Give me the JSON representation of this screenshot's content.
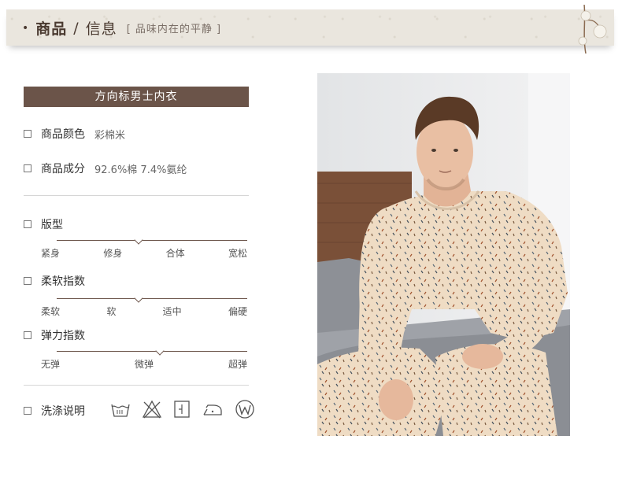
{
  "header": {
    "title_bold": "商品",
    "separator": "/",
    "title_sub": "信息",
    "tagline": "[ 品味内在的平静 ]"
  },
  "product": {
    "name": "方向标男士内衣"
  },
  "specs": {
    "color_label": "商品颜色",
    "color_value": "彩棉米",
    "composition_label": "商品成分",
    "composition_value": "92.6%棉  7.4%氨纶"
  },
  "scales": {
    "fit": {
      "label": "版型",
      "ticks": [
        "紧身",
        "修身",
        "合体",
        "宽松"
      ],
      "selected_fraction": 0.43
    },
    "softness": {
      "label": "柔软指数",
      "ticks": [
        "柔软",
        "软",
        "适中",
        "偏硬"
      ],
      "selected_fraction": 0.43
    },
    "elasticity": {
      "label": "弹力指数",
      "ticks": [
        "无弹",
        "微弹",
        "超弹"
      ],
      "selected_fraction": 0.54
    }
  },
  "washing": {
    "label": "洗涤说明",
    "icons": [
      "wash-30-icon",
      "no-bleach-icon",
      "line-dry-icon",
      "iron-low-icon",
      "wet-clean-icon"
    ]
  },
  "photo": {
    "subject": "man-in-patterned-thermal-underwear-icon"
  },
  "colors": {
    "accent": "#6b5449",
    "banner": "#eae6de",
    "garment": "#efdcc4"
  }
}
